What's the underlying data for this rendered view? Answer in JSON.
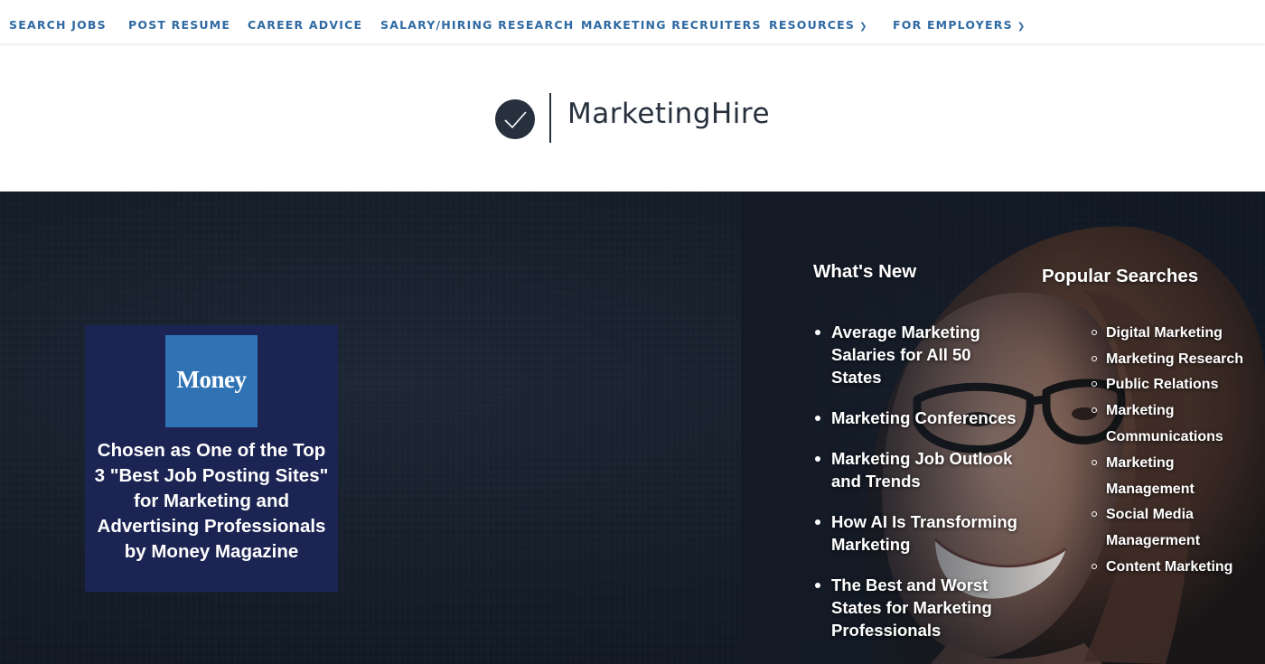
{
  "nav": {
    "items": [
      {
        "label": "SEARCH JOBS",
        "has_dropdown": false
      },
      {
        "label": "POST RESUME",
        "has_dropdown": false
      },
      {
        "label": "CAREER ADVICE",
        "has_dropdown": false
      },
      {
        "label": "SALARY/HIRING RESEARCH",
        "has_dropdown": false
      },
      {
        "label": "MARKETING RECRUITERS",
        "has_dropdown": false
      },
      {
        "label": "RESOURCES",
        "has_dropdown": true
      },
      {
        "label": "FOR EMPLOYERS",
        "has_dropdown": true
      }
    ],
    "dropdown_icon": "chevron-down-icon",
    "color": "#2f6aa3"
  },
  "logo": {
    "brand": "MarketingHire",
    "icon": "checkmark-circle-icon",
    "color": "#27303d"
  },
  "money_badge": {
    "logo_text": "Money",
    "caption": "Chosen as One of the Top 3 \"Best Job Posting Sites\" for Marketing and Advertising Professionals by Money Magazine",
    "bg_color": "#1c2453",
    "logo_color": "#2f73b5"
  },
  "whats_new": {
    "heading": "What's New",
    "items": [
      "Average Marketing Salaries for All 50 States",
      "Marketing Conferences",
      "Marketing Job Outlook and Trends",
      "How AI Is Transforming Marketing",
      "The Best and Worst States for Marketing Professionals"
    ]
  },
  "popular_searches": {
    "heading": "Popular Searches",
    "items": [
      "Digital Marketing",
      "Marketing Research",
      "Public Relations",
      "Marketing Communications",
      "Marketing Management",
      "Social Media Managerment",
      "Content Marketing"
    ]
  }
}
